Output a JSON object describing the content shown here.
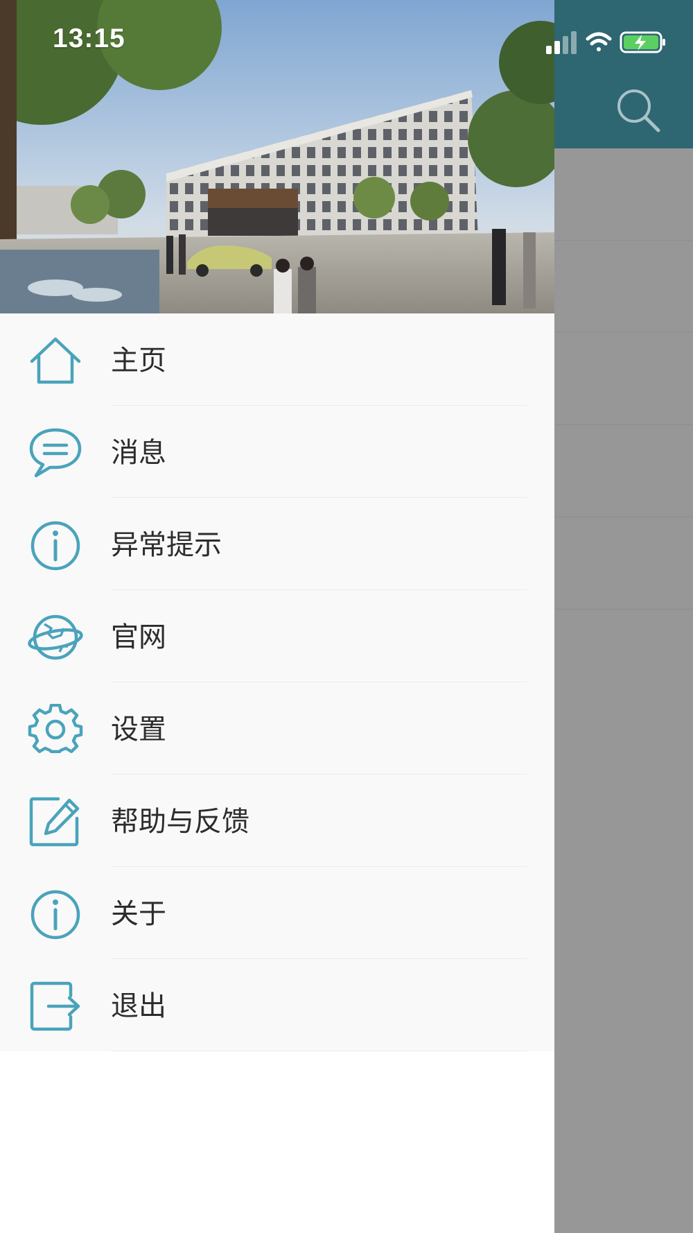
{
  "status_bar": {
    "time": "13:15"
  },
  "colors": {
    "header_bg": "#2e6672",
    "icon_accent": "#4aa3bb",
    "overlay": "#979797",
    "menu_bg": "#f9f9f9",
    "text": "#2c2c2c"
  },
  "menu": {
    "items": [
      {
        "label": "主页",
        "icon": "home-icon"
      },
      {
        "label": "消息",
        "icon": "message-icon"
      },
      {
        "label": "异常提示",
        "icon": "info-icon"
      },
      {
        "label": "官网",
        "icon": "globe-icon"
      },
      {
        "label": "设置",
        "icon": "gear-icon"
      },
      {
        "label": "帮助与反馈",
        "icon": "edit-icon"
      },
      {
        "label": "关于",
        "icon": "info-icon"
      },
      {
        "label": "退出",
        "icon": "logout-icon"
      }
    ]
  }
}
